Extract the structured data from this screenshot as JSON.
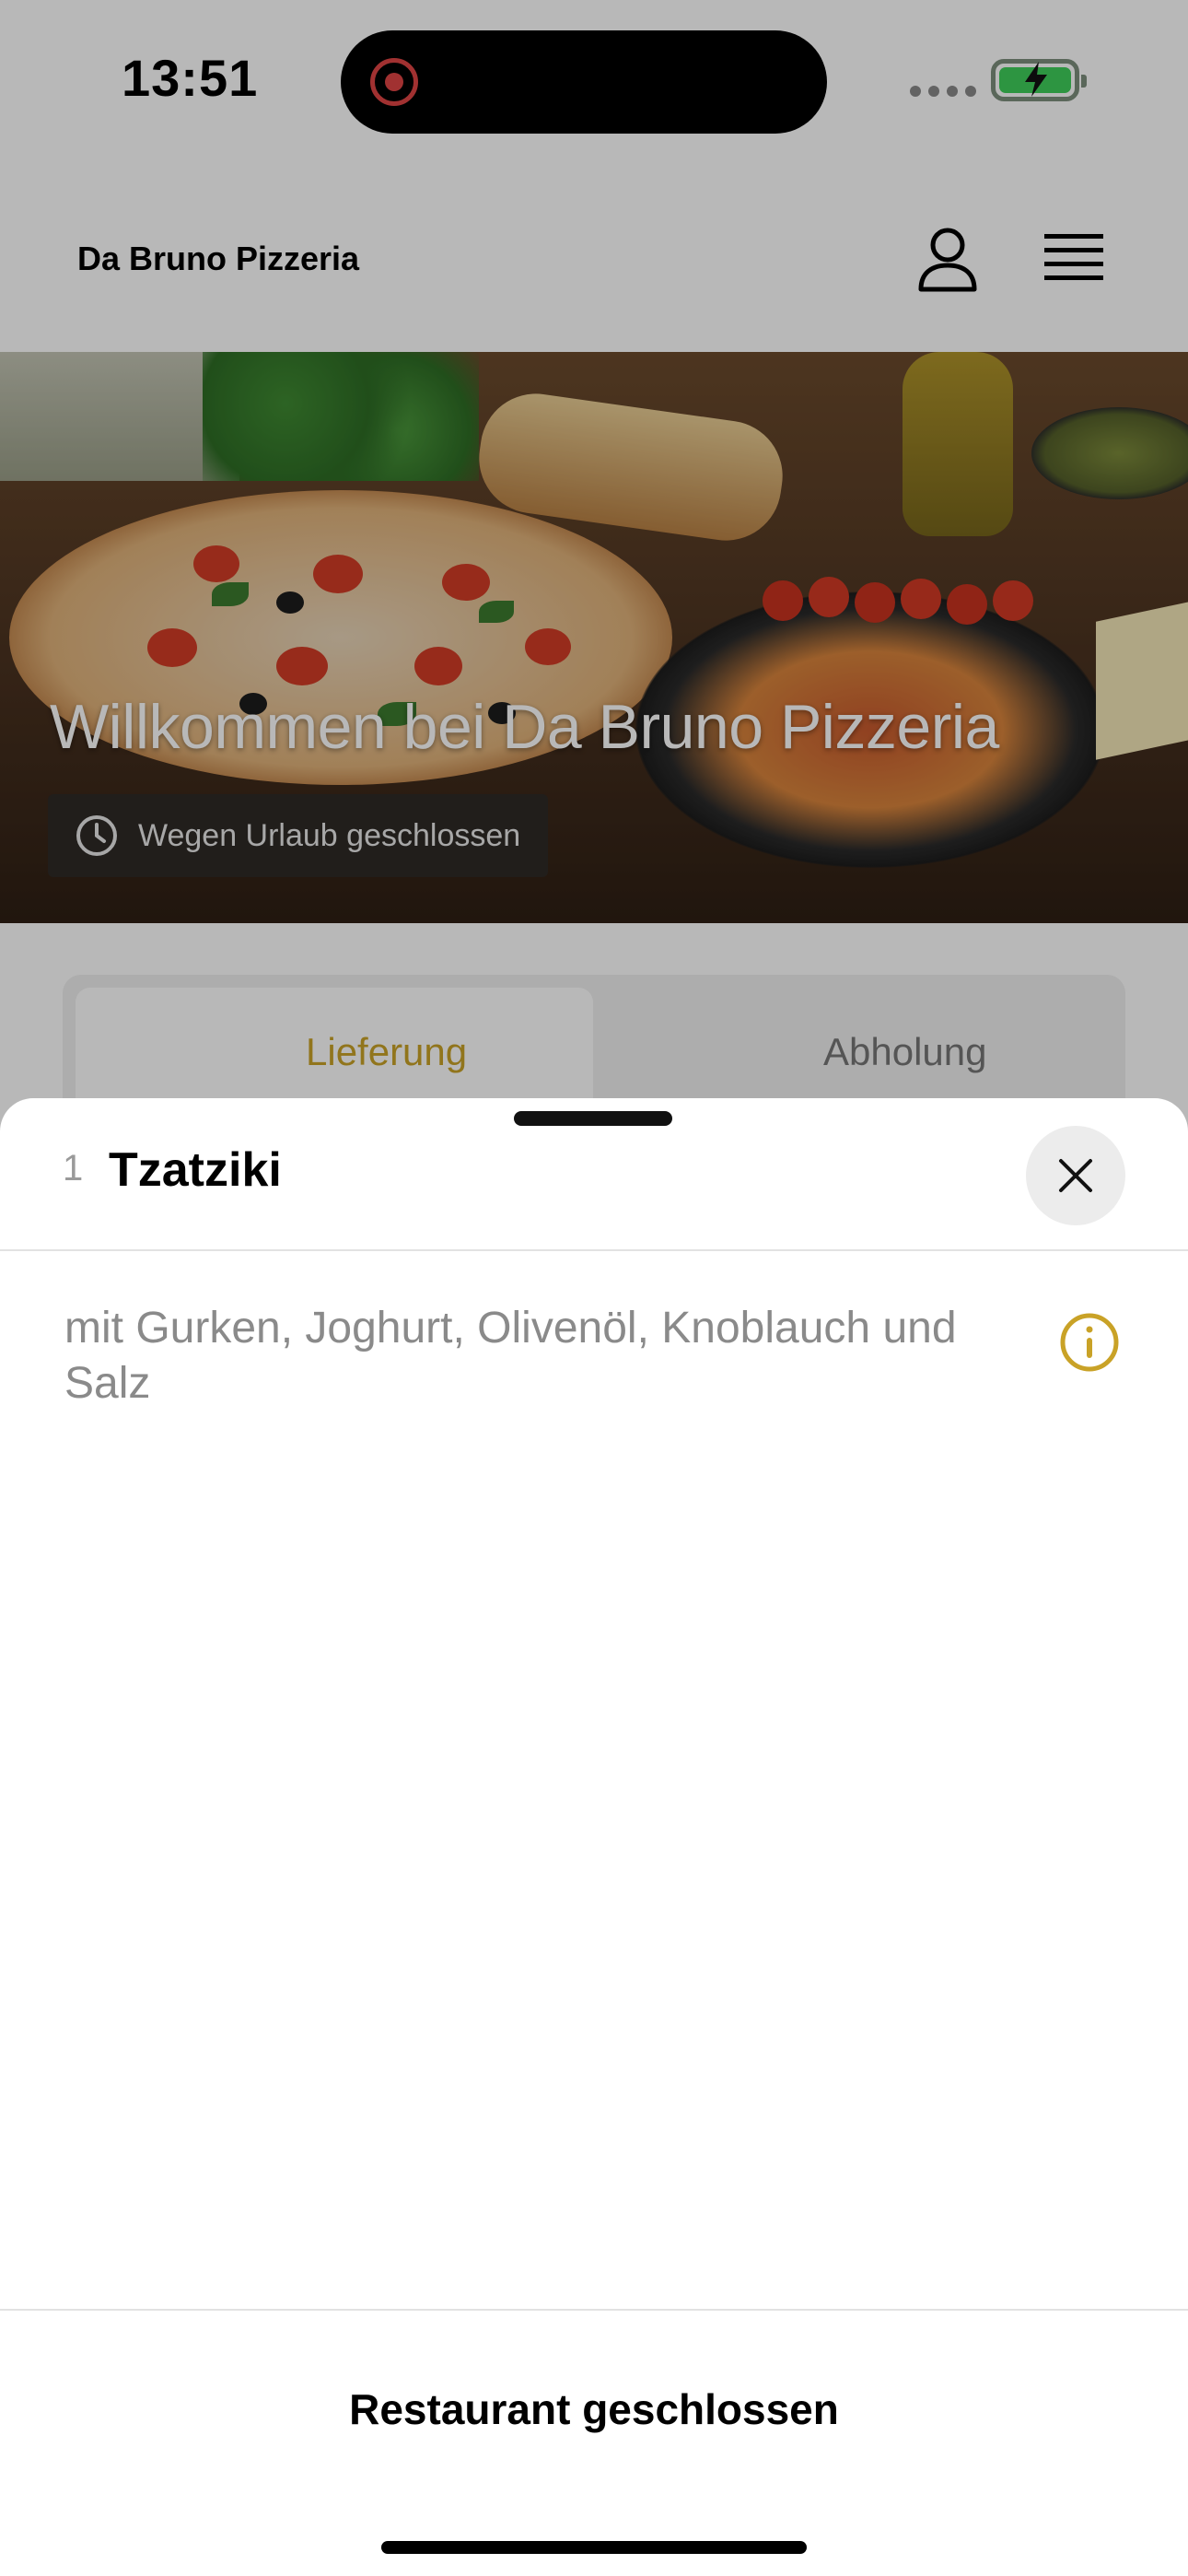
{
  "status_bar": {
    "time": "13:51",
    "recording_indicator": "screen-recording-icon",
    "battery_state": "charging"
  },
  "header": {
    "brand": "Da Bruno Pizzeria",
    "user_icon": "user-icon",
    "menu_icon": "menu-icon"
  },
  "hero": {
    "title": "Willkommen bei Da Bruno Pizzeria",
    "status_text": "Wegen Urlaub geschlossen",
    "status_icon": "clock-icon"
  },
  "order_mode": {
    "tabs": [
      {
        "label": "Lieferung",
        "active": true
      },
      {
        "label": "Abholung",
        "active": false
      }
    ]
  },
  "sheet": {
    "quantity": "1",
    "title": "Tzatziki",
    "description": "mit Gurken, Joghurt, Olivenöl, Knoblauch und Salz",
    "close_icon": "close-icon",
    "info_icon": "info-icon",
    "footer_button": "Restaurant geschlossen"
  },
  "colors": {
    "accent": "#c9a227",
    "sheet_bg": "#ffffff",
    "overlay": "rgba(0,0,0,0.28)",
    "muted_text": "#8a8a8a"
  }
}
